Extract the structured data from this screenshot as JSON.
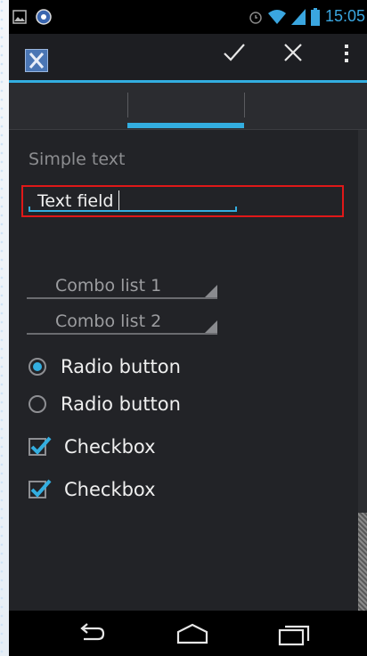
{
  "status_bar": {
    "time": "15:05",
    "icons": [
      "image-notification-icon",
      "notification-badge-icon",
      "alarm-icon",
      "wifi-icon",
      "signal-icon",
      "battery-icon"
    ]
  },
  "action_bar": {
    "app_icon": "x-app-icon",
    "actions": [
      "check-icon",
      "close-icon",
      "overflow-menu-icon"
    ]
  },
  "tabs": {
    "count": 3,
    "selected_index": 1
  },
  "form": {
    "simple_text": "Simple text",
    "text_field_value": "Text field",
    "combo1": "Combo list 1",
    "combo2": "Combo list 2",
    "radio1": {
      "label": "Radio button",
      "selected": true
    },
    "radio2": {
      "label": "Radio button",
      "selected": false
    },
    "check1": {
      "label": "Checkbox",
      "checked": true
    },
    "check2": {
      "label": "Checkbox",
      "checked": true
    }
  },
  "nav_bar": {
    "buttons": [
      "back-icon",
      "home-icon",
      "recents-icon"
    ]
  },
  "colors": {
    "accent": "#33aee0",
    "highlight_border": "#e01818",
    "background": "#222327"
  }
}
